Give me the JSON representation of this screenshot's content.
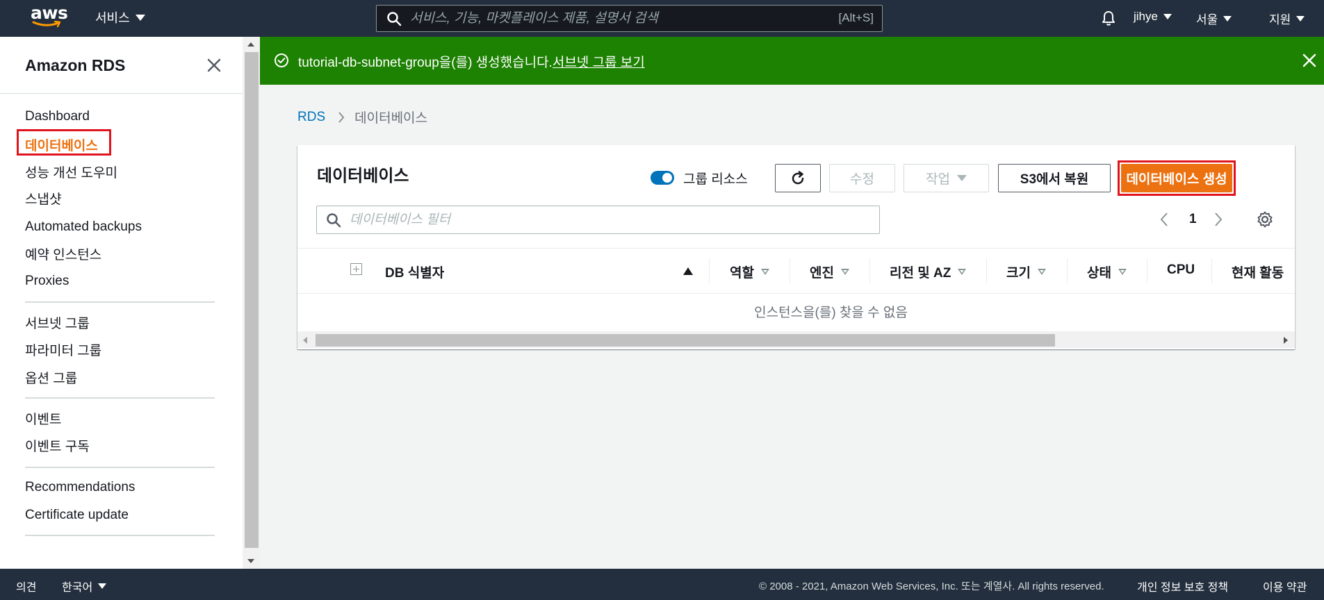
{
  "topnav": {
    "logo_text": "aws",
    "services_label": "서비스",
    "search_placeholder": "서비스, 기능, 마켓플레이스 제품, 설명서 검색",
    "search_shortcut": "[Alt+S]",
    "user": "jihye",
    "region": "서울",
    "support": "지원"
  },
  "sidebar": {
    "title": "Amazon RDS",
    "items": [
      {
        "label": "Dashboard"
      },
      {
        "label": "데이터베이스",
        "active": true
      },
      {
        "label": "성능 개선 도우미"
      },
      {
        "label": "스냅샷"
      },
      {
        "label": "Automated backups"
      },
      {
        "label": "예약 인스턴스"
      },
      {
        "label": "Proxies"
      },
      {
        "label": "서브넷 그룹"
      },
      {
        "label": "파라미터 그룹"
      },
      {
        "label": "옵션 그룹"
      },
      {
        "label": "이벤트"
      },
      {
        "label": "이벤트 구독"
      },
      {
        "label": "Recommendations"
      },
      {
        "label": "Certificate update"
      }
    ]
  },
  "flash": {
    "message": "tutorial-db-subnet-group을(를) 생성했습니다.",
    "link": "서브넷 그룹 보기",
    "color": "#1d8102"
  },
  "breadcrumb": {
    "root": "RDS",
    "current": "데이터베이스"
  },
  "panel": {
    "title": "데이터베이스",
    "group_toggle_label": "그룹 리소스",
    "group_toggle_on": true,
    "buttons": {
      "modify": "수정",
      "actions": "작업",
      "restore_s3": "S3에서 복원",
      "create": "데이터베이스 생성"
    },
    "filter_placeholder": "데이터베이스 필터",
    "page": "1",
    "columns": [
      "DB 식별자",
      "역할",
      "엔진",
      "리전 및 AZ",
      "크기",
      "상태",
      "CPU",
      "현재 활동"
    ],
    "empty_message": "인스턴스을(를) 찾을 수 없음",
    "accent_color": "#ec7211"
  },
  "footer": {
    "feedback": "의견",
    "language": "한국어",
    "copyright": "© 2008 - 2021, Amazon Web Services, Inc. 또는 계열사. All rights reserved.",
    "privacy": "개인 정보 보호 정책",
    "terms": "이용 약관"
  }
}
